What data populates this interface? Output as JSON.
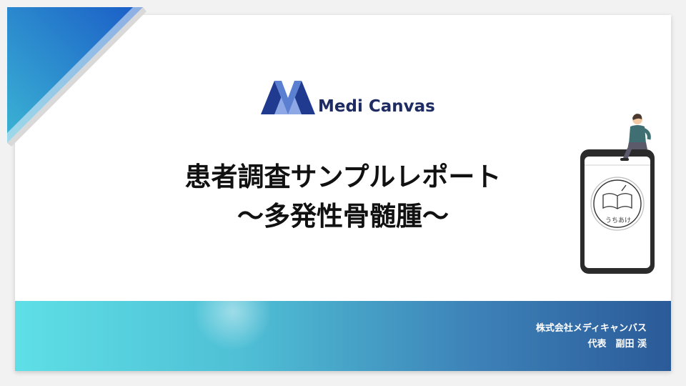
{
  "logo": {
    "icon": "medicanvas-logo-mark",
    "text": "Medi Canvas"
  },
  "title": {
    "line1": "患者調査サンプルレポート",
    "line2": "～多発性骨髄腫～"
  },
  "illustration": {
    "icon": "person-sitting-on-phone",
    "screen_icon": "open-book-icon",
    "screen_label": "うちあけ"
  },
  "footer": {
    "company": "株式会社メディキャンバス",
    "representative": "代表　副田 渓"
  },
  "colors": {
    "brand_navy": "#1e2c63",
    "accent_blue": "#2a6fbf",
    "accent_cyan": "#5edfe6"
  }
}
